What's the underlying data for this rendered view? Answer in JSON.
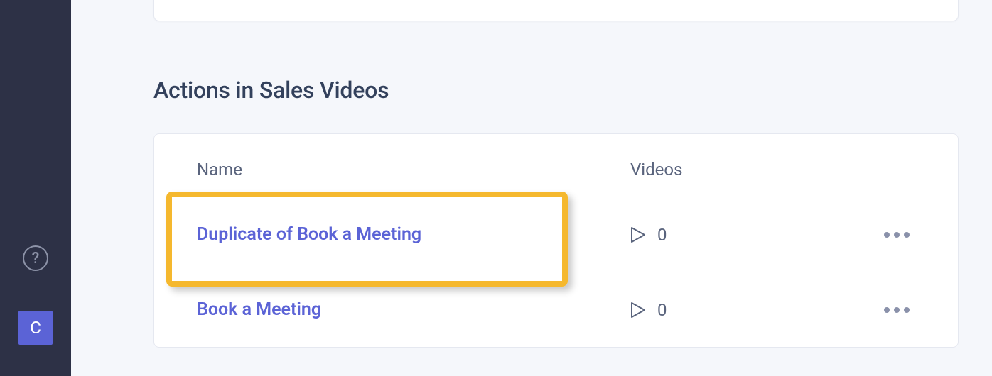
{
  "sidebar": {
    "help_label": "?",
    "avatar_letter": "C"
  },
  "main": {
    "section_title": "Actions in Sales Videos",
    "columns": {
      "name": "Name",
      "videos": "Videos"
    },
    "rows": [
      {
        "name": "Duplicate of Book a Meeting",
        "videos": "0"
      },
      {
        "name": "Book a Meeting",
        "videos": "0"
      }
    ]
  }
}
